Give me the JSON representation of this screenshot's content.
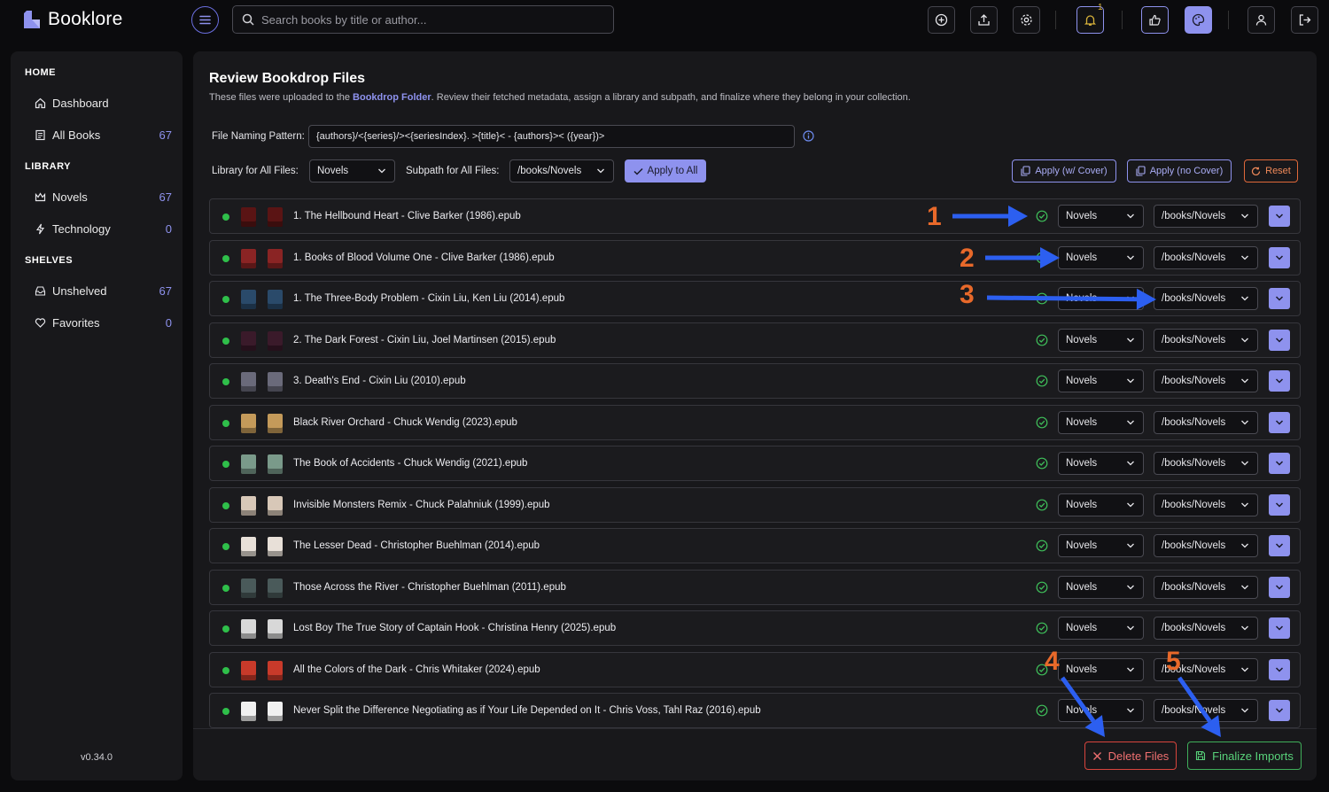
{
  "app": {
    "name": "Booklore",
    "version": "v0.34.0",
    "accent": "#8e92ee"
  },
  "search": {
    "placeholder": "Search books by title or author..."
  },
  "topbar": {
    "icons": [
      "add-circle-icon",
      "upload-icon",
      "settings-icon",
      "bell-icon",
      "thumbs-up-icon",
      "palette-icon",
      "user-icon",
      "logout-icon"
    ],
    "notification_count": "1"
  },
  "sidebar": {
    "sections": [
      {
        "title": "HOME",
        "items": [
          {
            "label": "Dashboard",
            "icon": "home-icon",
            "count": ""
          },
          {
            "label": "All Books",
            "icon": "book-list-icon",
            "count": "67"
          }
        ]
      },
      {
        "title": "LIBRARY",
        "items": [
          {
            "label": "Novels",
            "icon": "crown-icon",
            "count": "67"
          },
          {
            "label": "Technology",
            "icon": "bolt-icon",
            "count": "0"
          }
        ]
      },
      {
        "title": "SHELVES",
        "items": [
          {
            "label": "Unshelved",
            "icon": "inbox-icon",
            "count": "67"
          },
          {
            "label": "Favorites",
            "icon": "heart-icon",
            "count": "0"
          }
        ]
      }
    ]
  },
  "page": {
    "title": "Review Bookdrop Files",
    "subtitle_pre": "These files were uploaded to the ",
    "subtitle_link": "Bookdrop Folder",
    "subtitle_post": ". Review their fetched metadata, assign a library and subpath, and finalize where they belong in your collection.",
    "pattern_label": "File Naming Pattern:",
    "pattern_value": "{authors}/<{series}/><{seriesIndex}. >{title}< - {authors}>< ({year})>",
    "library_label": "Library for All Files:",
    "library_value": "Novels",
    "subpath_label": "Subpath for All Files:",
    "subpath_value": "/books/Novels",
    "apply_all": "Apply to All",
    "apply_cover": "Apply (w/ Cover)",
    "apply_no_cover": "Apply (no Cover)",
    "reset": "Reset"
  },
  "files": [
    {
      "name": "1. The Hellbound Heart - Clive Barker (1986).epub",
      "library": "Novels",
      "subpath": "/books/Novels",
      "cover": "#5a1414"
    },
    {
      "name": "1. Books of Blood Volume One - Clive Barker (1986).epub",
      "library": "Novels",
      "subpath": "/books/Novels",
      "cover": "#8a2424"
    },
    {
      "name": "1. The Three-Body Problem - Cixin Liu, Ken Liu (2014).epub",
      "library": "Novels",
      "subpath": "/books/Novels",
      "cover": "#2a4a6a"
    },
    {
      "name": "2. The Dark Forest - Cixin Liu, Joel Martinsen (2015).epub",
      "library": "Novels",
      "subpath": "/books/Novels",
      "cover": "#3a1a2a"
    },
    {
      "name": "3. Death's End - Cixin Liu (2010).epub",
      "library": "Novels",
      "subpath": "/books/Novels",
      "cover": "#6a6a7a"
    },
    {
      "name": "Black River Orchard - Chuck Wendig (2023).epub",
      "library": "Novels",
      "subpath": "/books/Novels",
      "cover": "#c49a5a"
    },
    {
      "name": "The Book of Accidents - Chuck Wendig (2021).epub",
      "library": "Novels",
      "subpath": "/books/Novels",
      "cover": "#7a9a8a"
    },
    {
      "name": "Invisible Monsters Remix - Chuck Palahniuk (1999).epub",
      "library": "Novels",
      "subpath": "/books/Novels",
      "cover": "#d8c8b8"
    },
    {
      "name": "The Lesser Dead - Christopher Buehlman (2014).epub",
      "library": "Novels",
      "subpath": "/books/Novels",
      "cover": "#e8e0d8"
    },
    {
      "name": "Those Across the River - Christopher Buehlman (2011).epub",
      "library": "Novels",
      "subpath": "/books/Novels",
      "cover": "#4a5a5a"
    },
    {
      "name": "Lost Boy The True Story of Captain Hook - Christina Henry (2025).epub",
      "library": "Novels",
      "subpath": "/books/Novels",
      "cover": "#d8d8d8"
    },
    {
      "name": "All the Colors of the Dark - Chris Whitaker (2024).epub",
      "library": "Novels",
      "subpath": "/books/Novels",
      "cover": "#c83a2a"
    },
    {
      "name": "Never Split the Difference Negotiating as if Your Life Depended on It - Chris Voss, Tahl Raz (2016).epub",
      "library": "Novels",
      "subpath": "/books/Novels",
      "cover": "#f0f0f0"
    }
  ],
  "footer": {
    "delete": "Delete Files",
    "finalize": "Finalize Imports"
  },
  "annotations": [
    "1",
    "2",
    "3",
    "4",
    "5"
  ],
  "annotation_color": "#e8692a",
  "arrow_color": "#2c5ff0"
}
